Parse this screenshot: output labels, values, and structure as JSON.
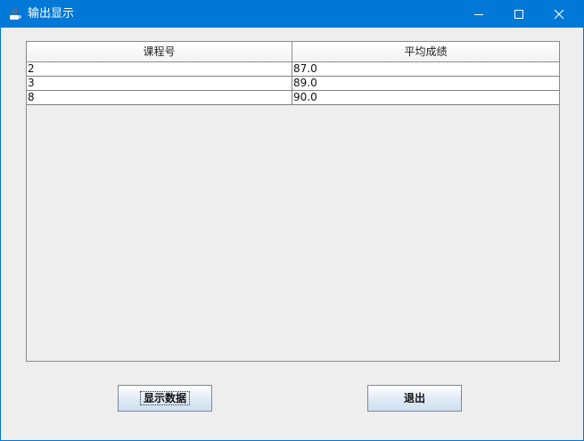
{
  "window": {
    "title": "输出显示",
    "controls": {
      "minimize": "minimize-icon",
      "maximize": "maximize-icon",
      "close": "close-icon"
    }
  },
  "table": {
    "columns": [
      "课程号",
      "平均成绩"
    ],
    "rows": [
      [
        "2",
        "87.0"
      ],
      [
        "3",
        "89.0"
      ],
      [
        "8",
        "90.0"
      ]
    ]
  },
  "buttons": {
    "show_data": "显示数据",
    "exit": "退出"
  },
  "colors": {
    "titlebar": "#0078d7",
    "window_bg": "#eeeeee"
  }
}
